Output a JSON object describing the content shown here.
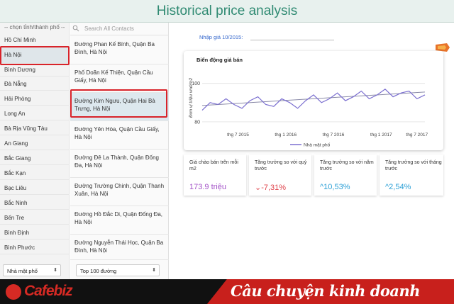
{
  "header": {
    "title": "Historical price analysis"
  },
  "provinces": {
    "header": "-- chọn tỉnh/thành phố --",
    "items": [
      "Hồ Chí Minh",
      "Hà Nội",
      "Bình Dương",
      "Đà Nẵng",
      "Hải Phòng",
      "Long An",
      "Bà Rịa Vũng Tàu",
      "An Giang",
      "Bắc Giang",
      "Bắc Kạn",
      "Bạc Liêu",
      "Bắc Ninh",
      "Bến Tre",
      "Bình Định",
      "Bình Phước"
    ],
    "selected": "Hà Nội",
    "type_select": "Nhà mặt phố"
  },
  "contacts": {
    "search_placeholder": "Search All Contacts",
    "items": [
      "Đường Phan Kế Bính, Quận Ba Đình, Hà Nội",
      "Phố Doãn Kế Thiện, Quận Cầu Giấy, Hà Nội",
      "Đường Kim Ngưu, Quận Hai Bà Trưng, Hà Nội",
      "Đường Yên Hòa, Quận Cầu Giấy, Hà Nội",
      "Đường Đê La Thành, Quận Đống Đa, Hà Nội",
      "Đường Trường Chinh, Quận Thanh Xuân, Hà Nội",
      "Đường Hồ Đắc Di, Quận Đống Đa, Hà Nội",
      "Đường Nguyễn Thái Học, Quận Ba Đình, Hà Nội"
    ],
    "selected_index": 2,
    "top_select": "Top 100 đường"
  },
  "main": {
    "nhap_gia_label": "Nhập giá 10/2015:"
  },
  "chart_data": {
    "type": "line",
    "title": "Biến động giá bán",
    "ylabel": "Đơn vị triệu vnd/m2",
    "x_ticks": [
      "thg 7 2015",
      "thg 1 2016",
      "thg 7 2016",
      "thg 1 2017",
      "thg 7 2017"
    ],
    "y_ticks": [
      80,
      100
    ],
    "ylim": [
      77,
      108
    ],
    "xlim": [
      0,
      28
    ],
    "legend": "Nhà mặt phố",
    "legend_position": "bottom",
    "series": [
      {
        "name": "Nhà mặt phố",
        "color": "#7b6fd0",
        "x": [
          0,
          1,
          2,
          3,
          4,
          5,
          6,
          7,
          8,
          9,
          10,
          11,
          12,
          13,
          14,
          15,
          16,
          17,
          18,
          19,
          20,
          21,
          22,
          23,
          24,
          25,
          26,
          27,
          28
        ],
        "values": [
          86,
          90,
          89,
          92,
          89,
          87,
          91,
          93,
          89,
          88,
          92,
          90,
          87,
          91,
          94,
          90,
          92,
          95,
          91,
          93,
          96,
          92,
          94,
          97,
          93,
          95,
          96,
          92,
          94
        ]
      }
    ],
    "trend": {
      "color": "#8a8aa8",
      "x": [
        0,
        28
      ],
      "values": [
        88.5,
        95.5
      ]
    }
  },
  "stats": [
    {
      "label": "Giá chào bán trên mỗi m2",
      "value": "173.9 triệu",
      "color": "#a454c8"
    },
    {
      "label": "Tăng trưởng so với quý trước",
      "value": "⌄-7,31%",
      "color": "#e0454d"
    },
    {
      "label": "Tăng trưởng so với năm trước",
      "value": "^10,53%",
      "color": "#2a9fd6"
    },
    {
      "label": "Tăng trưởng so với tháng trước",
      "value": "^2,54%",
      "color": "#2a9fd6"
    }
  ],
  "footer": {
    "logo": "Cafebiz",
    "slogan": "Câu chuyện kinh doanh",
    "brand_color": "#c8201c"
  }
}
